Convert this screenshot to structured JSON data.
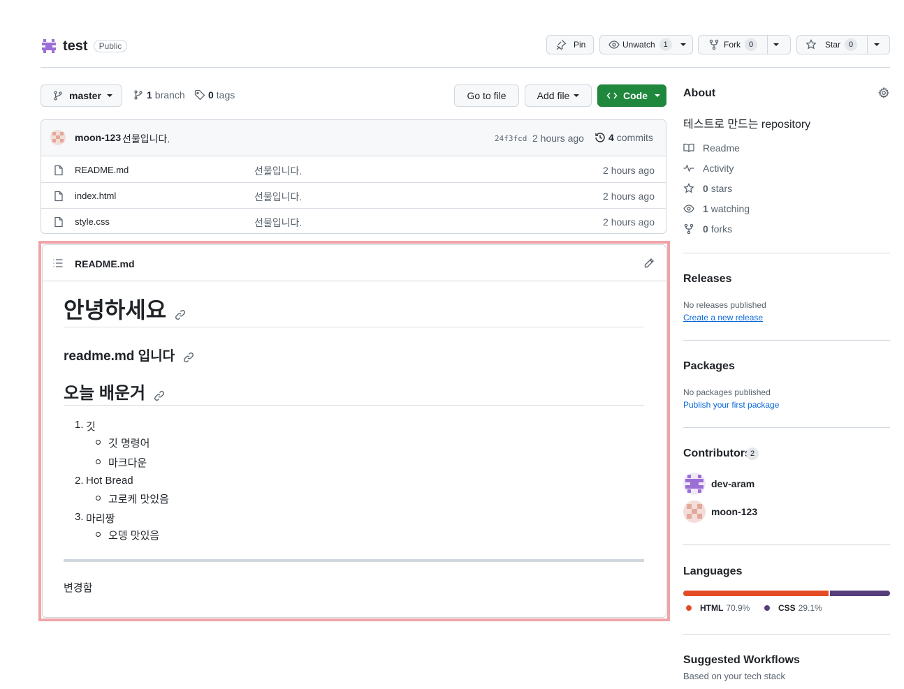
{
  "repo": {
    "name": "test",
    "visibility": "Public"
  },
  "header_actions": {
    "pin_label": "Pin",
    "watch_label": "Unwatch",
    "watch_count": "1",
    "fork_label": "Fork",
    "fork_count": "0",
    "star_label": "Star",
    "star_count": "0"
  },
  "toolbar": {
    "branch_name": "master",
    "branch_count": "1",
    "branch_word": "branch",
    "tag_count": "0",
    "tag_word": "tags",
    "go_to_file": "Go to file",
    "add_file": "Add file",
    "code": "Code"
  },
  "latest_commit": {
    "author": "moon-123",
    "message": "선물입니다.",
    "sha": "24f3fcd",
    "time": "2 hours ago",
    "commit_count": "4",
    "commit_word": "commits"
  },
  "files": [
    {
      "name": "README.md",
      "message": "선물입니다.",
      "time": "2 hours ago"
    },
    {
      "name": "index.html",
      "message": "선물입니다.",
      "time": "2 hours ago"
    },
    {
      "name": "style.css",
      "message": "선물입니다.",
      "time": "2 hours ago"
    }
  ],
  "readme": {
    "file_name": "README.md",
    "h1": "안녕하세요",
    "h2a": "readme.md 입니다",
    "h2b": "오늘 배운거",
    "list": [
      {
        "num": "1.",
        "text": "깃",
        "subs": [
          "깃 명령어",
          "마크다운"
        ]
      },
      {
        "num": "2.",
        "text": "Hot Bread",
        "subs": [
          "고로케 맛있음"
        ]
      },
      {
        "num": "3.",
        "text": "마리짱",
        "subs": [
          "오뎅 맛있음"
        ]
      }
    ],
    "footer_text": "변경함"
  },
  "about": {
    "title": "About",
    "description": "테스트로 만드는 repository",
    "readme": "Readme",
    "activity": "Activity",
    "stars_count": "0",
    "stars_word": "stars",
    "watching_count": "1",
    "watching_word": "watching",
    "forks_count": "0",
    "forks_word": "forks"
  },
  "releases": {
    "title": "Releases",
    "note": "No releases published",
    "link": "Create a new release"
  },
  "packages": {
    "title": "Packages",
    "note": "No packages published",
    "link": "Publish your first package"
  },
  "contributors": {
    "title": "Contributors",
    "count": "2",
    "people": [
      "dev-aram",
      "moon-123"
    ]
  },
  "languages": {
    "title": "Languages",
    "items": [
      {
        "name": "HTML",
        "percent": "70.9%",
        "fraction": 0.709,
        "color": "#e34c26"
      },
      {
        "name": "CSS",
        "percent": "29.1%",
        "fraction": 0.291,
        "color": "#563d7c"
      }
    ]
  },
  "workflows": {
    "title": "Suggested Workflows",
    "subtitle": "Based on your tech stack"
  },
  "colors": {
    "primary_green": "#1f883d",
    "link_blue": "#0969da",
    "highlight_border": "#f0a4a8"
  }
}
